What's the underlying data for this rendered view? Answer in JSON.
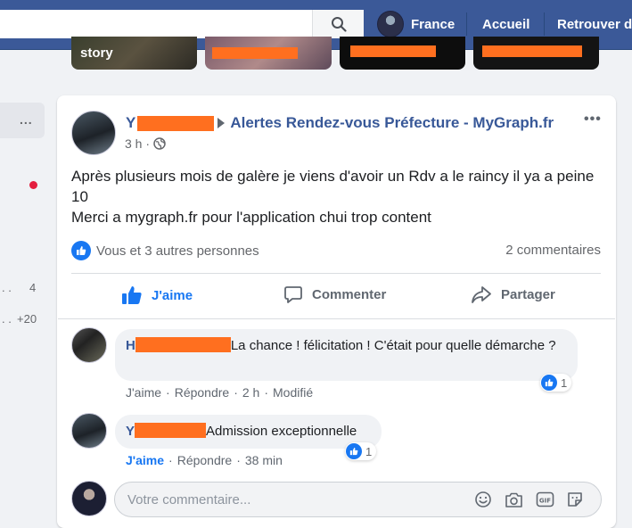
{
  "topbar": {
    "search_placeholder": "",
    "profile_name": "France",
    "links": [
      "Accueil",
      "Retrouver d"
    ]
  },
  "stories": {
    "first_label": "story"
  },
  "left_column": {
    "count_1": "4",
    "count_2": "+20",
    "dots_1": "...",
    "dots_2": ". ."
  },
  "post": {
    "author_initial": "Y",
    "group": "Alertes Rendez-vous Préfecture - MyGraph.fr",
    "time": "3 h ·",
    "text_line1": "Après plusieurs mois de galère je viens d'avoir un Rdv a le raincy il ya a peine 10",
    "text_line2": "Merci a mygraph.fr pour l'application chui trop content",
    "reactions_text": "Vous et 3 autres personnes",
    "comments_count": "2 commentaires",
    "actions": {
      "like": "J'aime",
      "comment": "Commenter",
      "share": "Partager"
    }
  },
  "comments": [
    {
      "author_initial": "H",
      "text": "La chance ! félicitation ! C'était pour quelle démarche ?",
      "like": "J'aime",
      "reply": "Répondre",
      "time": "2 h",
      "edited": "Modifié",
      "reaction_count": "1"
    },
    {
      "author_initial": "Y",
      "text": "Admission exceptionnelle",
      "like": "J'aime",
      "reply": "Répondre",
      "time": "38 min",
      "reaction_count": "1"
    }
  ],
  "composer": {
    "placeholder": "Votre commentaire..."
  },
  "colors": {
    "brand": "#3b5998",
    "link": "#385898",
    "like_blue": "#1877f2",
    "redaction": "#ff6f1f"
  }
}
